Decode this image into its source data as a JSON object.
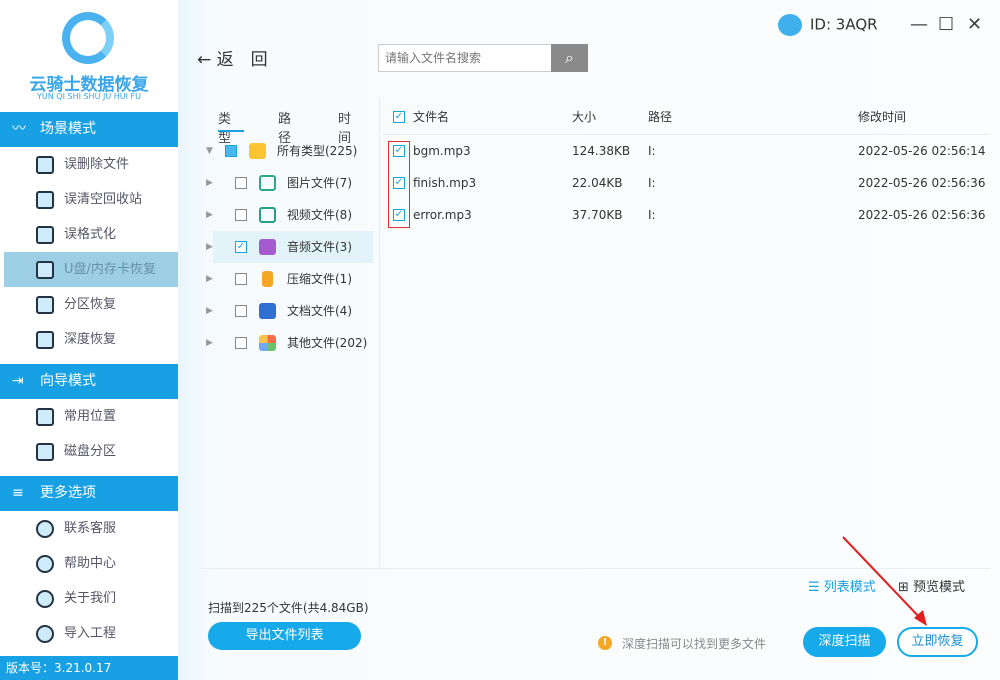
{
  "app": {
    "logo_title": "云骑士数据恢复",
    "logo_subtitle": "YUN QI SHI SHU JU HUI FU",
    "id_label": "ID: 3AQR",
    "version": "版本号：3.21.0.17"
  },
  "sidebar": {
    "sections": [
      {
        "label": "场景模式",
        "items": [
          "误删除文件",
          "误清空回收站",
          "误格式化",
          "U盘/内存卡恢复",
          "分区恢复",
          "深度恢复"
        ]
      },
      {
        "label": "向导模式",
        "items": [
          "常用位置",
          "磁盘分区"
        ]
      },
      {
        "label": "更多选项",
        "items": [
          "联系客服",
          "帮助中心",
          "关于我们",
          "导入工程"
        ]
      }
    ],
    "selected": "U盘/内存卡恢复"
  },
  "toolbar": {
    "back": "返　回",
    "search_placeholder": "请输入文件名搜索"
  },
  "tree": {
    "tabs": [
      "类型",
      "路径",
      "时间"
    ],
    "root": "所有类型(225)",
    "items": [
      "图片文件(7)",
      "视频文件(8)",
      "音频文件(3)",
      "压缩文件(1)",
      "文档文件(4)",
      "其他文件(202)"
    ]
  },
  "list": {
    "headers": [
      "文件名",
      "大小",
      "路径",
      "修改时间"
    ],
    "rows": [
      {
        "name": "bgm.mp3",
        "size": "124.38KB",
        "path": "I:",
        "time": "2022-05-26 02:56:14"
      },
      {
        "name": "finish.mp3",
        "size": "22.04KB",
        "path": "I:",
        "time": "2022-05-26 02:56:36"
      },
      {
        "name": "error.mp3",
        "size": "37.70KB",
        "path": "I:",
        "time": "2022-05-26 02:56:36"
      }
    ]
  },
  "footer": {
    "list_mode": "列表模式",
    "preview_mode": "预览模式",
    "scan_info": "扫描到225个文件(共4.84GB)",
    "export": "导出文件列表",
    "tip": "深度扫描可以找到更多文件",
    "deep_scan": "深度扫描",
    "recover": "立即恢复"
  }
}
